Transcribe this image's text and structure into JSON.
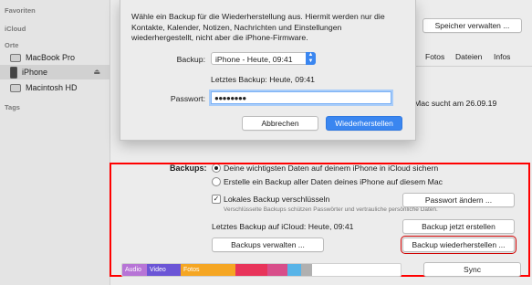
{
  "sidebar": {
    "favorites": "Favoriten",
    "icloud": "iCloud",
    "places": "Orte",
    "items": [
      {
        "label": "MacBook Pro",
        "icon": "laptop-icon"
      },
      {
        "label": "iPhone",
        "icon": "iphone-icon",
        "selected": true
      },
      {
        "label": "Macintosh HD",
        "icon": "disk-icon"
      }
    ],
    "tags": "Tags"
  },
  "main": {
    "manage_storage": "Speicher verwalten ...",
    "tabs": [
      "Fotos",
      "Dateien",
      "Infos"
    ],
    "update_hint": "Mac sucht am 26.09.19",
    "backups_label": "Backups:",
    "radio_icloud": "Deine wichtigsten Daten auf deinem iPhone in iCloud sichern",
    "radio_mac": "Erstelle ein Backup aller Daten deines iPhone auf diesem Mac",
    "encrypt_label": "Lokales Backup verschlüsseln",
    "encrypt_sub": "Verschlüsselte Backups schützen Passwörter und vertrauliche persönliche Daten.",
    "change_password": "Passwort ändern ...",
    "last_backup_icloud": "Letztes Backup auf iCloud: Heute, 09:41",
    "backup_now": "Backup jetzt erstellen",
    "manage_backups": "Backups verwalten ...",
    "restore_backup": "Backup wiederherstellen ...",
    "sync": "Sync"
  },
  "storage": [
    {
      "label": "Audio",
      "color": "#b774d6"
    },
    {
      "label": "Video",
      "color": "#6b55d6"
    },
    {
      "label": "Fotos",
      "color": "#f5a623"
    },
    {
      "label": "",
      "color": "#e8345a"
    },
    {
      "label": "",
      "color": "#d84e8a"
    },
    {
      "label": "",
      "color": "#58b4e8"
    },
    {
      "label": "",
      "color": "#b0b0b0"
    }
  ],
  "dialog": {
    "message": "Wähle ein Backup für die Wiederherstellung aus. Hiermit werden nur die Kontakte, Kalender, Notizen, Nachrichten und Einstellungen wiederhergestellt, nicht aber die iPhone-Firmware.",
    "backup_label": "Backup:",
    "backup_value": "iPhone - Heute, 09:41",
    "last_backup": "Letztes Backup:  Heute, 09:41",
    "password_label": "Passwort:",
    "password_value": "●●●●●●●●",
    "cancel": "Abbrechen",
    "restore": "Wiederherstellen"
  }
}
